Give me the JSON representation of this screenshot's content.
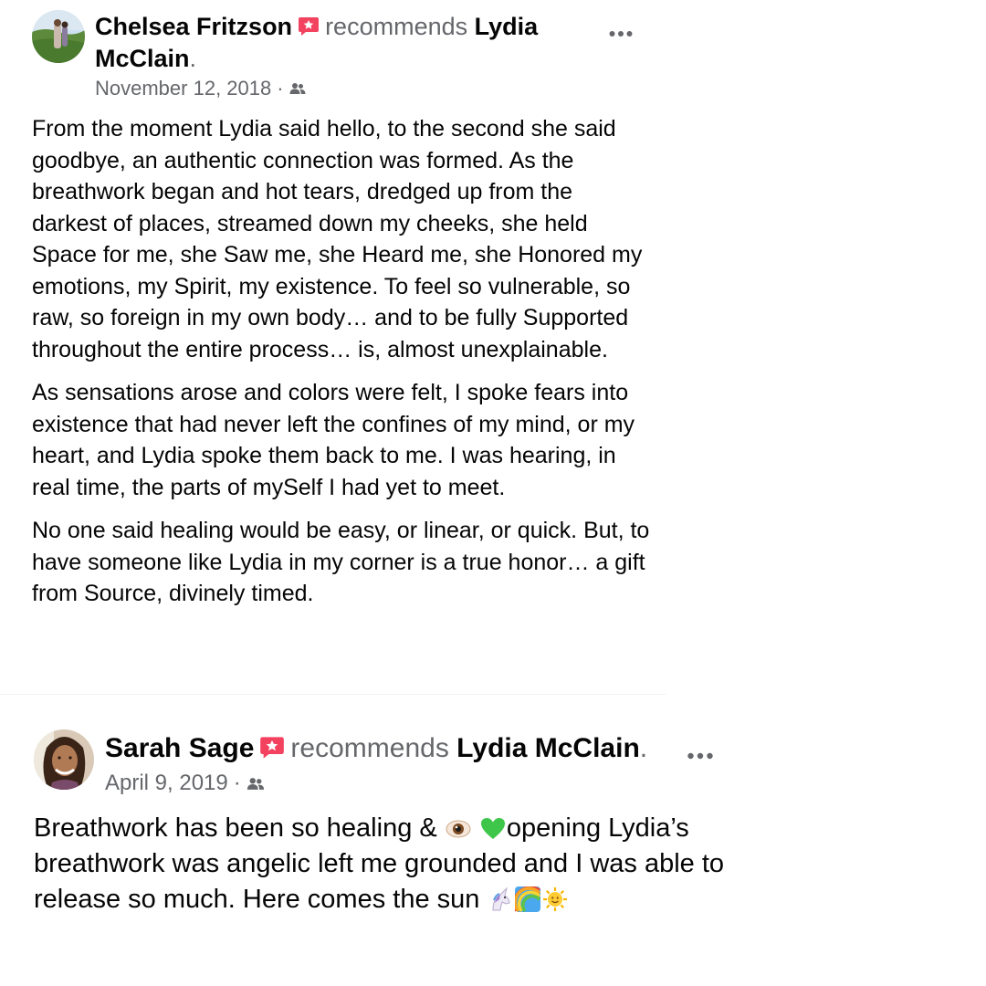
{
  "posts": [
    {
      "author": "Chelsea Fritzson",
      "action": "recommends",
      "target_line1": "Lydia",
      "target_line2": "McClain",
      "period": ".",
      "date": "November 12, 2018",
      "separator": "·",
      "audience_icon": "friends-icon",
      "badge_icon": "recommend-star-icon",
      "more_icon": "more-options-icon",
      "paragraphs": [
        "From the moment Lydia said hello, to the second she said goodbye, an authentic connection was formed. As the breathwork began and hot tears, dredged up from the darkest of places, streamed down my cheeks, she held Space for me, she Saw me, she Heard me, she Honored my emotions, my Spirit, my existence. To feel so vulnerable, so raw, so foreign in my own body… and to be fully Supported throughout the entire process… is, almost unexplainable.",
        "As sensations arose and colors were felt, I spoke fears into existence that had never left the confines of my mind, or my heart, and Lydia spoke them back to me. I was hearing, in real time, the parts of mySelf I had yet to meet.",
        "No one said healing would be easy, or linear, or quick. But, to have someone like Lydia in my corner is a true honor… a gift from Source, divinely timed."
      ]
    },
    {
      "author": "Sarah Sage",
      "action": "recommends",
      "target": "Lydia McClain",
      "period": ".",
      "date": "April 9, 2019",
      "separator": "·",
      "audience_icon": "friends-icon",
      "badge_icon": "recommend-star-icon",
      "more_icon": "more-options-icon",
      "text_part1": "Breathwork has been so healing & ",
      "text_part2": "opening Lydia’s breathwork was angelic left me grounded and I was able to release so much. Here comes the sun ",
      "emoji_icons": [
        "eye-emoji-icon",
        "green-heart-emoji-icon",
        "unicorn-emoji-icon",
        "rainbow-emoji-icon",
        "sun-emoji-icon"
      ]
    }
  ],
  "colors": {
    "text": "#050505",
    "secondary_text": "#65676b",
    "badge": "#f3425f",
    "background": "#ffffff"
  }
}
